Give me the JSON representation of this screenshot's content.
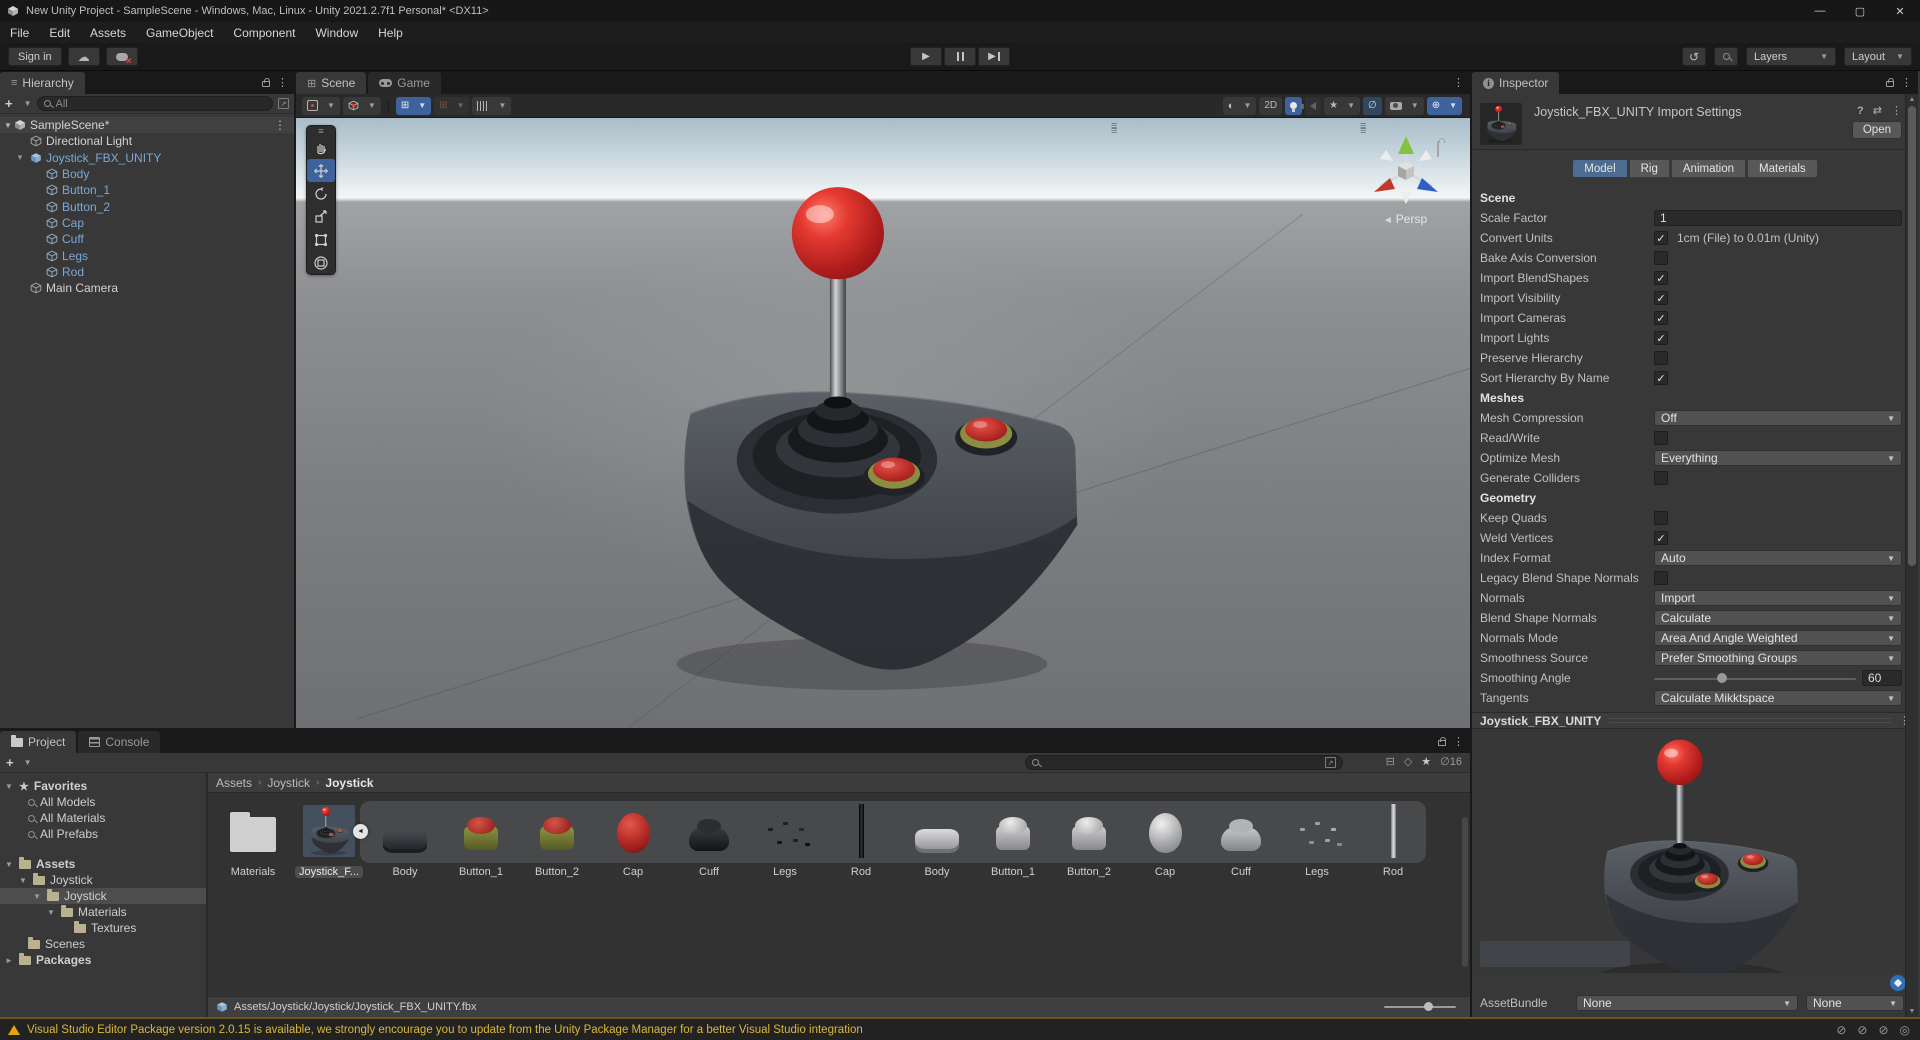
{
  "window": {
    "title": "New Unity Project - SampleScene - Windows, Mac, Linux - Unity 2021.2.7f1 Personal* <DX11>",
    "menus": [
      "File",
      "Edit",
      "Assets",
      "GameObject",
      "Component",
      "Window",
      "Help"
    ]
  },
  "toolbar": {
    "sign_in": "Sign in",
    "layers": "Layers",
    "layout": "Layout"
  },
  "hierarchy": {
    "tab": "Hierarchy",
    "search_scope": "All",
    "items": [
      {
        "label": "SampleScene*"
      },
      {
        "label": "Directional Light"
      },
      {
        "label": "Joystick_FBX_UNITY"
      },
      {
        "label": "Body"
      },
      {
        "label": "Button_1"
      },
      {
        "label": "Button_2"
      },
      {
        "label": "Cap"
      },
      {
        "label": "Cuff"
      },
      {
        "label": "Legs"
      },
      {
        "label": "Rod"
      },
      {
        "label": "Main Camera"
      }
    ]
  },
  "scene": {
    "tab_scene": "Scene",
    "tab_game": "Game",
    "btn_2d": "2D",
    "persp_label": "Persp"
  },
  "inspector": {
    "tab": "Inspector",
    "title": "Joystick_FBX_UNITY Import Settings",
    "open_button": "Open",
    "tabs": [
      "Model",
      "Rig",
      "Animation",
      "Materials"
    ],
    "active_tab": "Model",
    "rows": [
      {
        "type": "header",
        "label": "Scene"
      },
      {
        "type": "input",
        "label": "Scale Factor",
        "value": "1"
      },
      {
        "type": "check",
        "label": "Convert Units",
        "checked": true,
        "note": "1cm (File) to 0.01m (Unity)"
      },
      {
        "type": "check",
        "label": "Bake Axis Conversion",
        "checked": false
      },
      {
        "type": "check",
        "label": "Import BlendShapes",
        "checked": true
      },
      {
        "type": "check",
        "label": "Import Visibility",
        "checked": true
      },
      {
        "type": "check",
        "label": "Import Cameras",
        "checked": true
      },
      {
        "type": "check",
        "label": "Import Lights",
        "checked": true
      },
      {
        "type": "check",
        "label": "Preserve Hierarchy",
        "checked": false
      },
      {
        "type": "check",
        "label": "Sort Hierarchy By Name",
        "checked": true
      },
      {
        "type": "header",
        "label": "Meshes"
      },
      {
        "type": "dropdown",
        "label": "Mesh Compression",
        "value": "Off"
      },
      {
        "type": "check",
        "label": "Read/Write",
        "checked": false
      },
      {
        "type": "dropdown",
        "label": "Optimize Mesh",
        "value": "Everything"
      },
      {
        "type": "check",
        "label": "Generate Colliders",
        "checked": false
      },
      {
        "type": "header",
        "label": "Geometry"
      },
      {
        "type": "check",
        "label": "Keep Quads",
        "checked": false
      },
      {
        "type": "check",
        "label": "Weld Vertices",
        "checked": true
      },
      {
        "type": "dropdown",
        "label": "Index Format",
        "value": "Auto"
      },
      {
        "type": "check",
        "label": "Legacy Blend Shape Normals",
        "checked": false
      },
      {
        "type": "dropdown",
        "label": "Normals",
        "value": "Import"
      },
      {
        "type": "dropdown",
        "label": "Blend Shape Normals",
        "value": "Calculate"
      },
      {
        "type": "dropdown",
        "label": "Normals Mode",
        "value": "Area And Angle Weighted"
      },
      {
        "type": "dropdown",
        "label": "Smoothness Source",
        "value": "Prefer Smoothing Groups"
      },
      {
        "type": "slider",
        "label": "Smoothing Angle",
        "value": "60"
      },
      {
        "type": "dropdown",
        "label": "Tangents",
        "value": "Calculate Mikktspace"
      }
    ],
    "footer": "Joystick_FBX_UNITY",
    "assetbundle_label": "AssetBundle",
    "assetbundle_value": "None",
    "assetbundle_variant": "None"
  },
  "project": {
    "tab_project": "Project",
    "tab_console": "Console",
    "tree": [
      {
        "label": "Favorites"
      },
      {
        "label": "All Models"
      },
      {
        "label": "All Materials"
      },
      {
        "label": "All Prefabs"
      },
      {
        "label": "Assets"
      },
      {
        "label": "Joystick"
      },
      {
        "label": "Joystick"
      },
      {
        "label": "Materials"
      },
      {
        "label": "Textures"
      },
      {
        "label": "Scenes"
      },
      {
        "label": "Packages"
      }
    ],
    "breadcrumb": [
      "Assets",
      "Joystick",
      "Joystick"
    ],
    "assets": [
      {
        "label": "Materials"
      },
      {
        "label": "Joystick_F..."
      },
      {
        "label": "Body"
      },
      {
        "label": "Button_1"
      },
      {
        "label": "Button_2"
      },
      {
        "label": "Cap"
      },
      {
        "label": "Cuff"
      },
      {
        "label": "Legs"
      },
      {
        "label": "Rod"
      },
      {
        "label": "Body"
      },
      {
        "label": "Button_1"
      },
      {
        "label": "Button_2"
      },
      {
        "label": "Cap"
      },
      {
        "label": "Cuff"
      },
      {
        "label": "Legs"
      },
      {
        "label": "Rod"
      }
    ],
    "path": "Assets/Joystick/Joystick/Joystick_FBX_UNITY.fbx",
    "hidden_count": "16"
  },
  "status": {
    "message": "Visual Studio Editor Package version 2.0.15 is available, we strongly encourage you to update from the Unity Package Manager for a better Visual Studio integration"
  },
  "colors": {
    "accent_blue": "#3e639c",
    "prefab_text": "#7ba8d8",
    "warning_text": "#d9b73a",
    "selection_gray": "#4d4d4d"
  }
}
